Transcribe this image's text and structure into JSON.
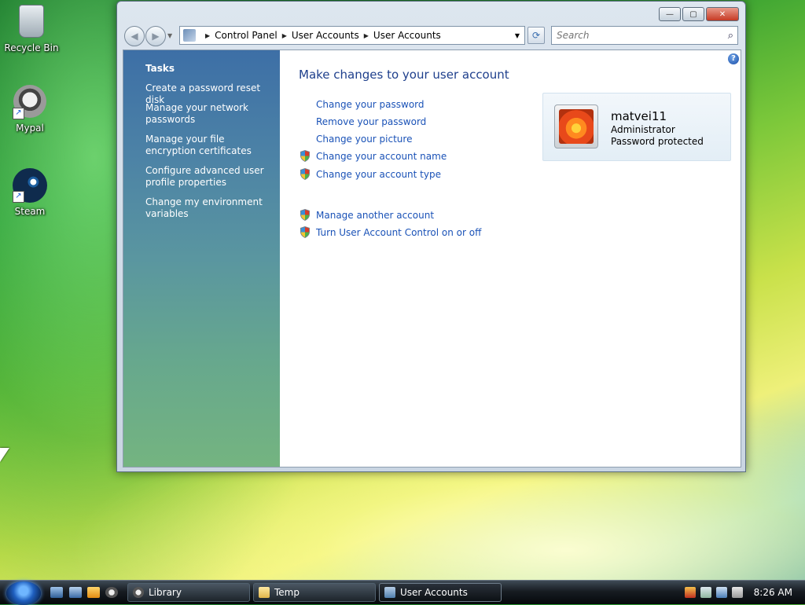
{
  "desktop": {
    "icons": [
      {
        "label": "Recycle Bin",
        "icon": "recycle-bin-icon"
      },
      {
        "label": "Mypal",
        "icon": "mypal-icon"
      },
      {
        "label": "Steam",
        "icon": "steam-icon"
      }
    ]
  },
  "window": {
    "controls": {
      "minimize": "—",
      "maximize": "▢",
      "close": "✕"
    },
    "breadcrumbs": [
      "Control Panel",
      "User Accounts",
      "User Accounts"
    ],
    "search_placeholder": "Search",
    "refresh": "⟳"
  },
  "sidebar": {
    "title": "Tasks",
    "tasks": [
      "Create a password reset disk",
      "Manage your network passwords",
      "Manage your file encryption certificates",
      "Configure advanced user profile properties",
      "Change my environment variables"
    ]
  },
  "main": {
    "title": "Make changes to your user account",
    "help": "?",
    "links": [
      {
        "label": "Change your password",
        "shield": false
      },
      {
        "label": "Remove your password",
        "shield": false
      },
      {
        "label": "Change your picture",
        "shield": false
      },
      {
        "label": "Change your account name",
        "shield": true
      },
      {
        "label": "Change your account type",
        "shield": true
      },
      {
        "label": "Manage another account",
        "shield": true
      },
      {
        "label": "Turn User Account Control on or off",
        "shield": true
      }
    ]
  },
  "user": {
    "name": "matvei11",
    "role": "Administrator",
    "status": "Password protected"
  },
  "taskbar": {
    "buttons": [
      {
        "label": "Library",
        "active": false
      },
      {
        "label": "Temp",
        "active": false
      },
      {
        "label": "User Accounts",
        "active": true
      }
    ],
    "clock": "8:26 AM"
  },
  "colors": {
    "link": "#1a52b7",
    "title": "#1e3f8c",
    "sidebar_top": "#3d6fa6",
    "sidebar_bottom": "#74b480"
  }
}
